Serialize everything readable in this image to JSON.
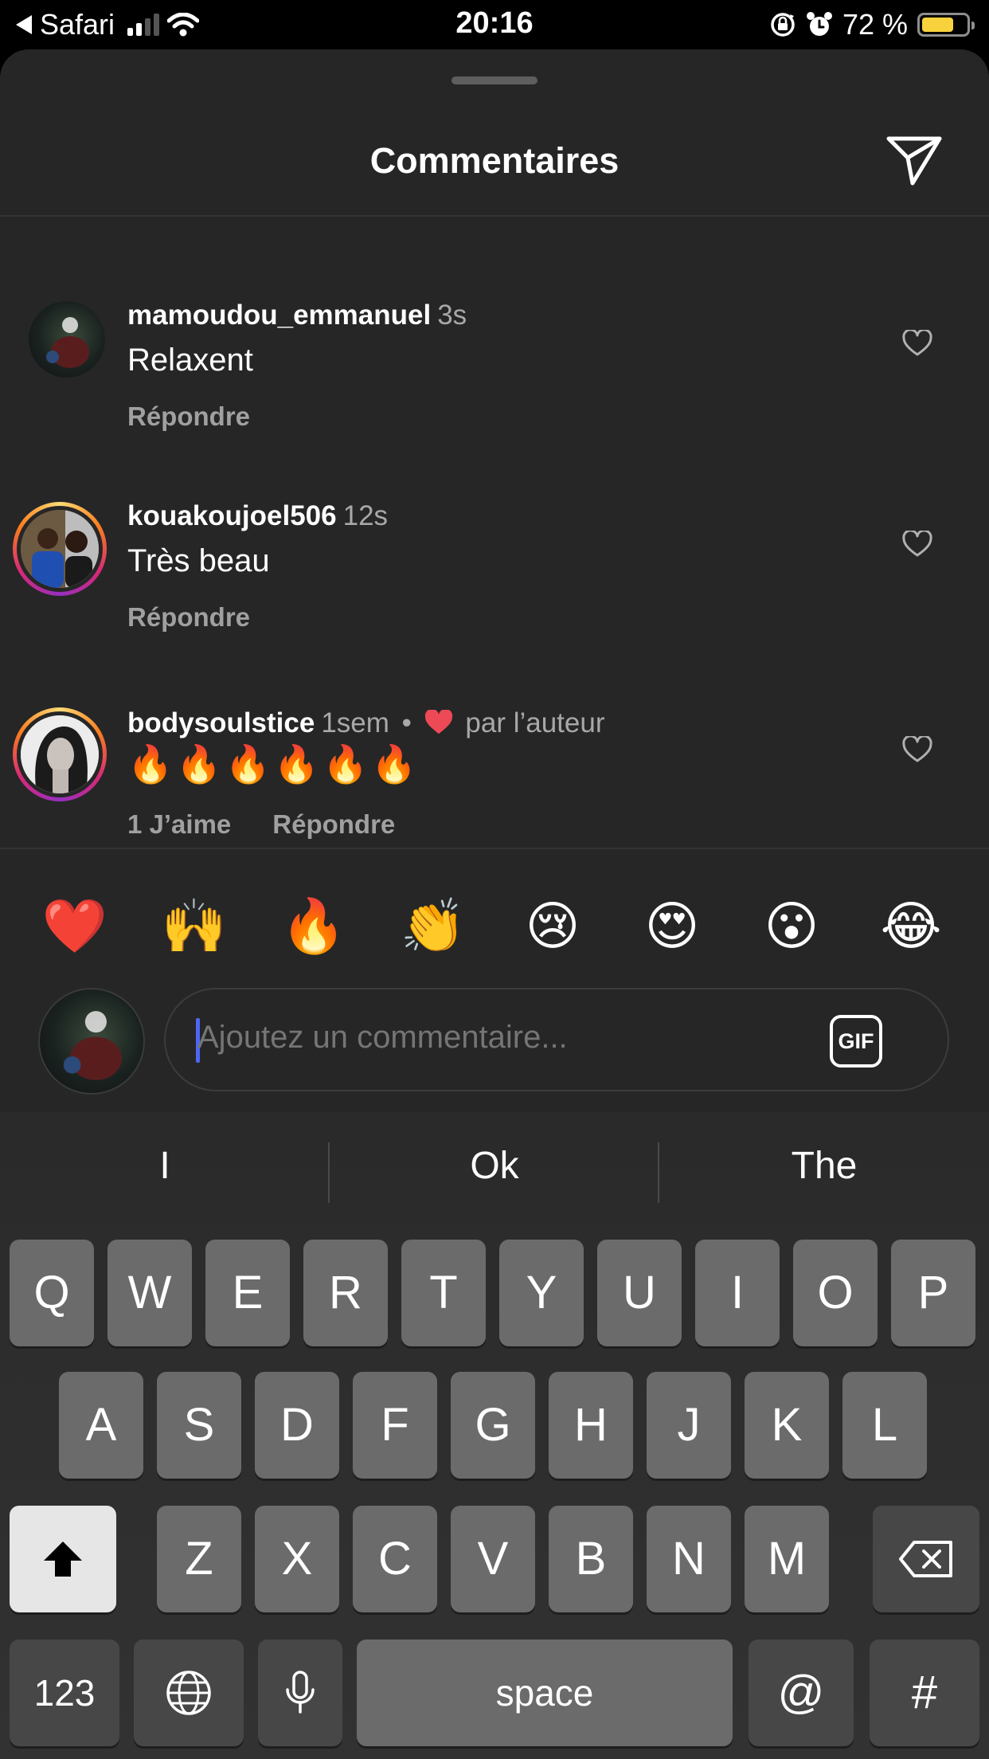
{
  "status_bar": {
    "back_app": "Safari",
    "time": "20:16",
    "battery_text": "72 %",
    "battery_level": 0.72
  },
  "sheet": {
    "title": "Commentaires"
  },
  "comments": [
    {
      "username": "mamoudou_emmanuel",
      "time": "3s",
      "text": "Relaxent",
      "reply_label": "Répondre"
    },
    {
      "username": "kouakoujoel506",
      "time": "12s",
      "text": "Très beau",
      "reply_label": "Répondre"
    },
    {
      "username": "bodysoulstice",
      "time": "1sem",
      "liked_by_author_sep": "•",
      "liked_by_author": "par l’auteur",
      "text": "🔥🔥🔥🔥🔥🔥",
      "likes_label": "1 J’aime",
      "reply_label": "Répondre"
    }
  ],
  "quick_reactions": [
    "❤️",
    "🙌",
    "🔥",
    "👏",
    "😢",
    "😍",
    "😮",
    "😂"
  ],
  "composer": {
    "placeholder": "Ajoutez un commentaire...",
    "gif_label": "GIF"
  },
  "keyboard": {
    "suggestions": [
      "I",
      "Ok",
      "The"
    ],
    "row1": [
      "Q",
      "W",
      "E",
      "R",
      "T",
      "Y",
      "U",
      "I",
      "O",
      "P"
    ],
    "row2": [
      "A",
      "S",
      "D",
      "F",
      "G",
      "H",
      "J",
      "K",
      "L"
    ],
    "row3": [
      "Z",
      "X",
      "C",
      "V",
      "B",
      "N",
      "M"
    ],
    "numbers_label": "123",
    "space_label": "space",
    "at_label": "@",
    "hash_label": "#"
  },
  "colors": {
    "sheet_bg": "#262626",
    "heart_red": "#ed4956",
    "caret_blue": "#4c67f5",
    "battery_yellow": "#f7d23c"
  }
}
